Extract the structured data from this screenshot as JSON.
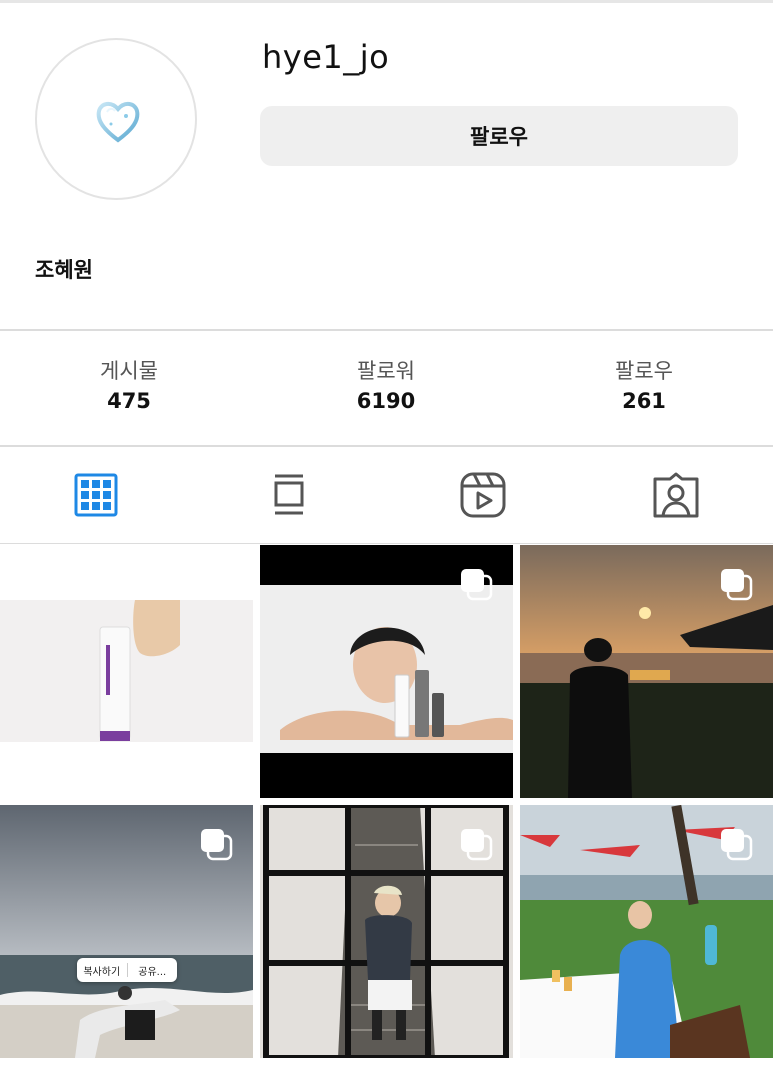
{
  "profile": {
    "username": "hye1_jo",
    "full_name": "조혜원",
    "follow_label": "팔로우",
    "avatar_icon": "water-heart-icon"
  },
  "stats": [
    {
      "label": "게시물",
      "value": "475"
    },
    {
      "label": "팔로워",
      "value": "6190"
    },
    {
      "label": "팔로우",
      "value": "261"
    }
  ],
  "tabs": [
    {
      "icon": "grid-icon",
      "active": true
    },
    {
      "icon": "feed-icon",
      "active": false
    },
    {
      "icon": "reels-icon",
      "active": false
    },
    {
      "icon": "tagged-icon",
      "active": false
    }
  ],
  "context_menu": {
    "copy_label": "복사하기",
    "share_label": "공유..."
  },
  "colors": {
    "accent": "#1e88e5",
    "button_bg": "#efefef",
    "icon_gray": "#555555"
  }
}
